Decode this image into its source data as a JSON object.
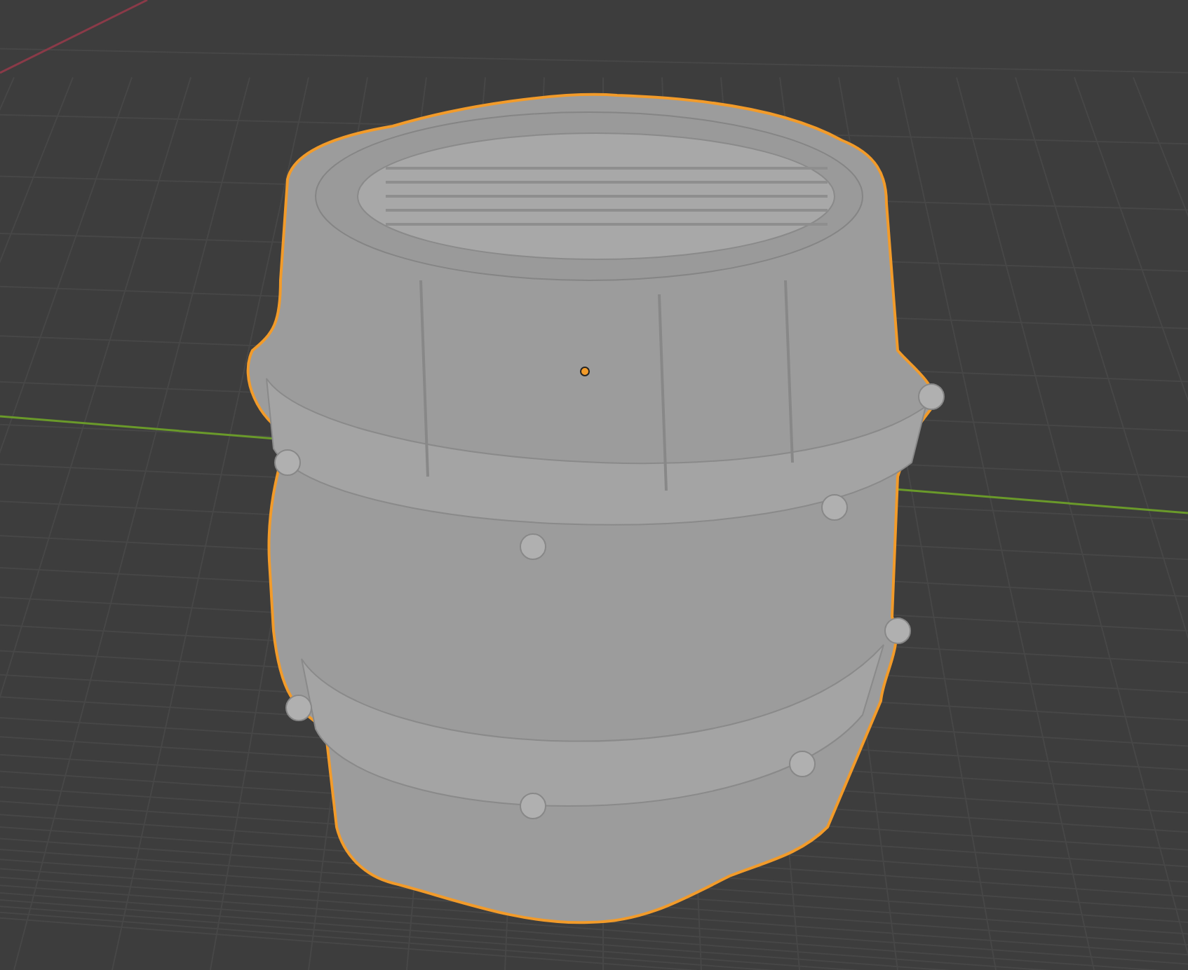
{
  "viewport": {
    "objects": [
      {
        "kind": "barrel",
        "selected": true
      }
    ]
  }
}
